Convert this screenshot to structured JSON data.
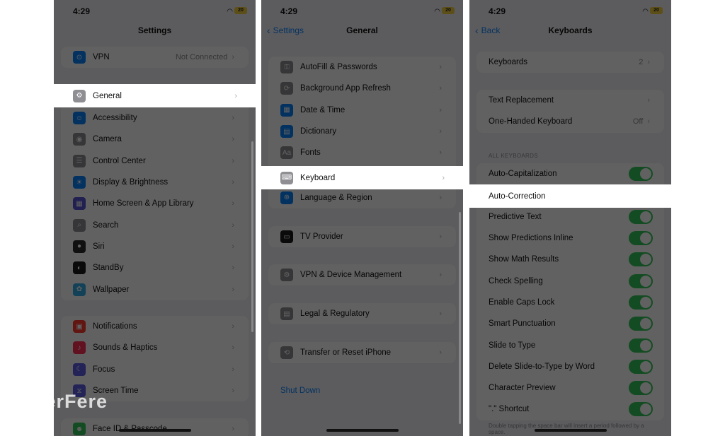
{
  "status": {
    "time": "4:29",
    "battery": "20"
  },
  "panel1": {
    "title": "Settings",
    "vpn": {
      "label": "VPN",
      "value": "Not Connected"
    },
    "highlighted": {
      "label": "General"
    },
    "items_a": [
      {
        "label": "Accessibility",
        "icon": "accessibility-icon",
        "color": "#0a84ff",
        "glyph": "☺"
      },
      {
        "label": "Camera",
        "icon": "camera-icon",
        "color": "#8e8e93",
        "glyph": "◉"
      },
      {
        "label": "Control Center",
        "icon": "control-center-icon",
        "color": "#8e8e93",
        "glyph": "☰"
      },
      {
        "label": "Display & Brightness",
        "icon": "brightness-icon",
        "color": "#0a84ff",
        "glyph": "☀"
      },
      {
        "label": "Home Screen & App Library",
        "icon": "home-screen-icon",
        "color": "#5856d6",
        "glyph": "▦"
      },
      {
        "label": "Search",
        "icon": "search-icon",
        "color": "#8e8e93",
        "glyph": "⌕"
      },
      {
        "label": "Siri",
        "icon": "siri-icon",
        "color": "#2c2c2e",
        "glyph": "●"
      },
      {
        "label": "StandBy",
        "icon": "standby-icon",
        "color": "#1c1c1e",
        "glyph": "◐"
      },
      {
        "label": "Wallpaper",
        "icon": "wallpaper-icon",
        "color": "#32ade6",
        "glyph": "✿"
      }
    ],
    "items_b": [
      {
        "label": "Notifications",
        "icon": "notifications-icon",
        "color": "#ff3b30",
        "glyph": "▣"
      },
      {
        "label": "Sounds & Haptics",
        "icon": "sounds-icon",
        "color": "#ff2d55",
        "glyph": "♪"
      },
      {
        "label": "Focus",
        "icon": "focus-icon",
        "color": "#5e5ce6",
        "glyph": "☾"
      },
      {
        "label": "Screen Time",
        "icon": "screen-time-icon",
        "color": "#5e5ce6",
        "glyph": "⧖"
      }
    ],
    "items_c": [
      {
        "label": "Face ID & Passcode",
        "icon": "face-id-icon",
        "color": "#34c759",
        "glyph": "☻"
      }
    ]
  },
  "panel2": {
    "back": "Settings",
    "title": "General",
    "items_a": [
      {
        "label": "AutoFill & Passwords",
        "icon": "autofill-icon",
        "color": "#8e8e93",
        "glyph": "⚿"
      },
      {
        "label": "Background App Refresh",
        "icon": "refresh-icon",
        "color": "#8e8e93",
        "glyph": "⟳"
      },
      {
        "label": "Date & Time",
        "icon": "calendar-icon",
        "color": "#0a84ff",
        "glyph": "▦"
      },
      {
        "label": "Dictionary",
        "icon": "dictionary-icon",
        "color": "#0a84ff",
        "glyph": "▤"
      },
      {
        "label": "Fonts",
        "icon": "fonts-icon",
        "color": "#8e8e93",
        "glyph": "Aa"
      }
    ],
    "highlighted": {
      "label": "Keyboard"
    },
    "items_b": [
      {
        "label": "Language & Region",
        "icon": "globe-icon",
        "color": "#0a84ff",
        "glyph": "⊕"
      }
    ],
    "tv": {
      "label": "TV Provider"
    },
    "vpn": {
      "label": "VPN & Device Management"
    },
    "legal": {
      "label": "Legal & Regulatory"
    },
    "reset": {
      "label": "Transfer or Reset iPhone"
    },
    "shutdown": "Shut Down"
  },
  "panel3": {
    "back": "Back",
    "title": "Keyboards",
    "keyboards": {
      "label": "Keyboards",
      "value": "2"
    },
    "text_replacement": {
      "label": "Text Replacement"
    },
    "one_handed": {
      "label": "One-Handed Keyboard",
      "value": "Off"
    },
    "section_header": "ALL KEYBOARDS",
    "toggles_a": [
      {
        "label": "Auto-Capitalization",
        "on": true
      }
    ],
    "highlighted": {
      "label": "Auto-Correction",
      "on": false
    },
    "toggles_b": [
      {
        "label": "Predictive Text",
        "on": true
      },
      {
        "label": "Show Predictions Inline",
        "on": true
      },
      {
        "label": "Show Math Results",
        "on": true
      },
      {
        "label": "Check Spelling",
        "on": true
      },
      {
        "label": "Enable Caps Lock",
        "on": true
      },
      {
        "label": "Smart Punctuation",
        "on": true
      },
      {
        "label": "Slide to Type",
        "on": true
      },
      {
        "label": "Delete Slide-to-Type by Word",
        "on": true
      },
      {
        "label": "Character Preview",
        "on": true
      },
      {
        "label": "\".\" Shortcut",
        "on": true
      }
    ],
    "footer": "Double tapping the space bar will insert a period followed by a space."
  },
  "watermark": "FerFere"
}
